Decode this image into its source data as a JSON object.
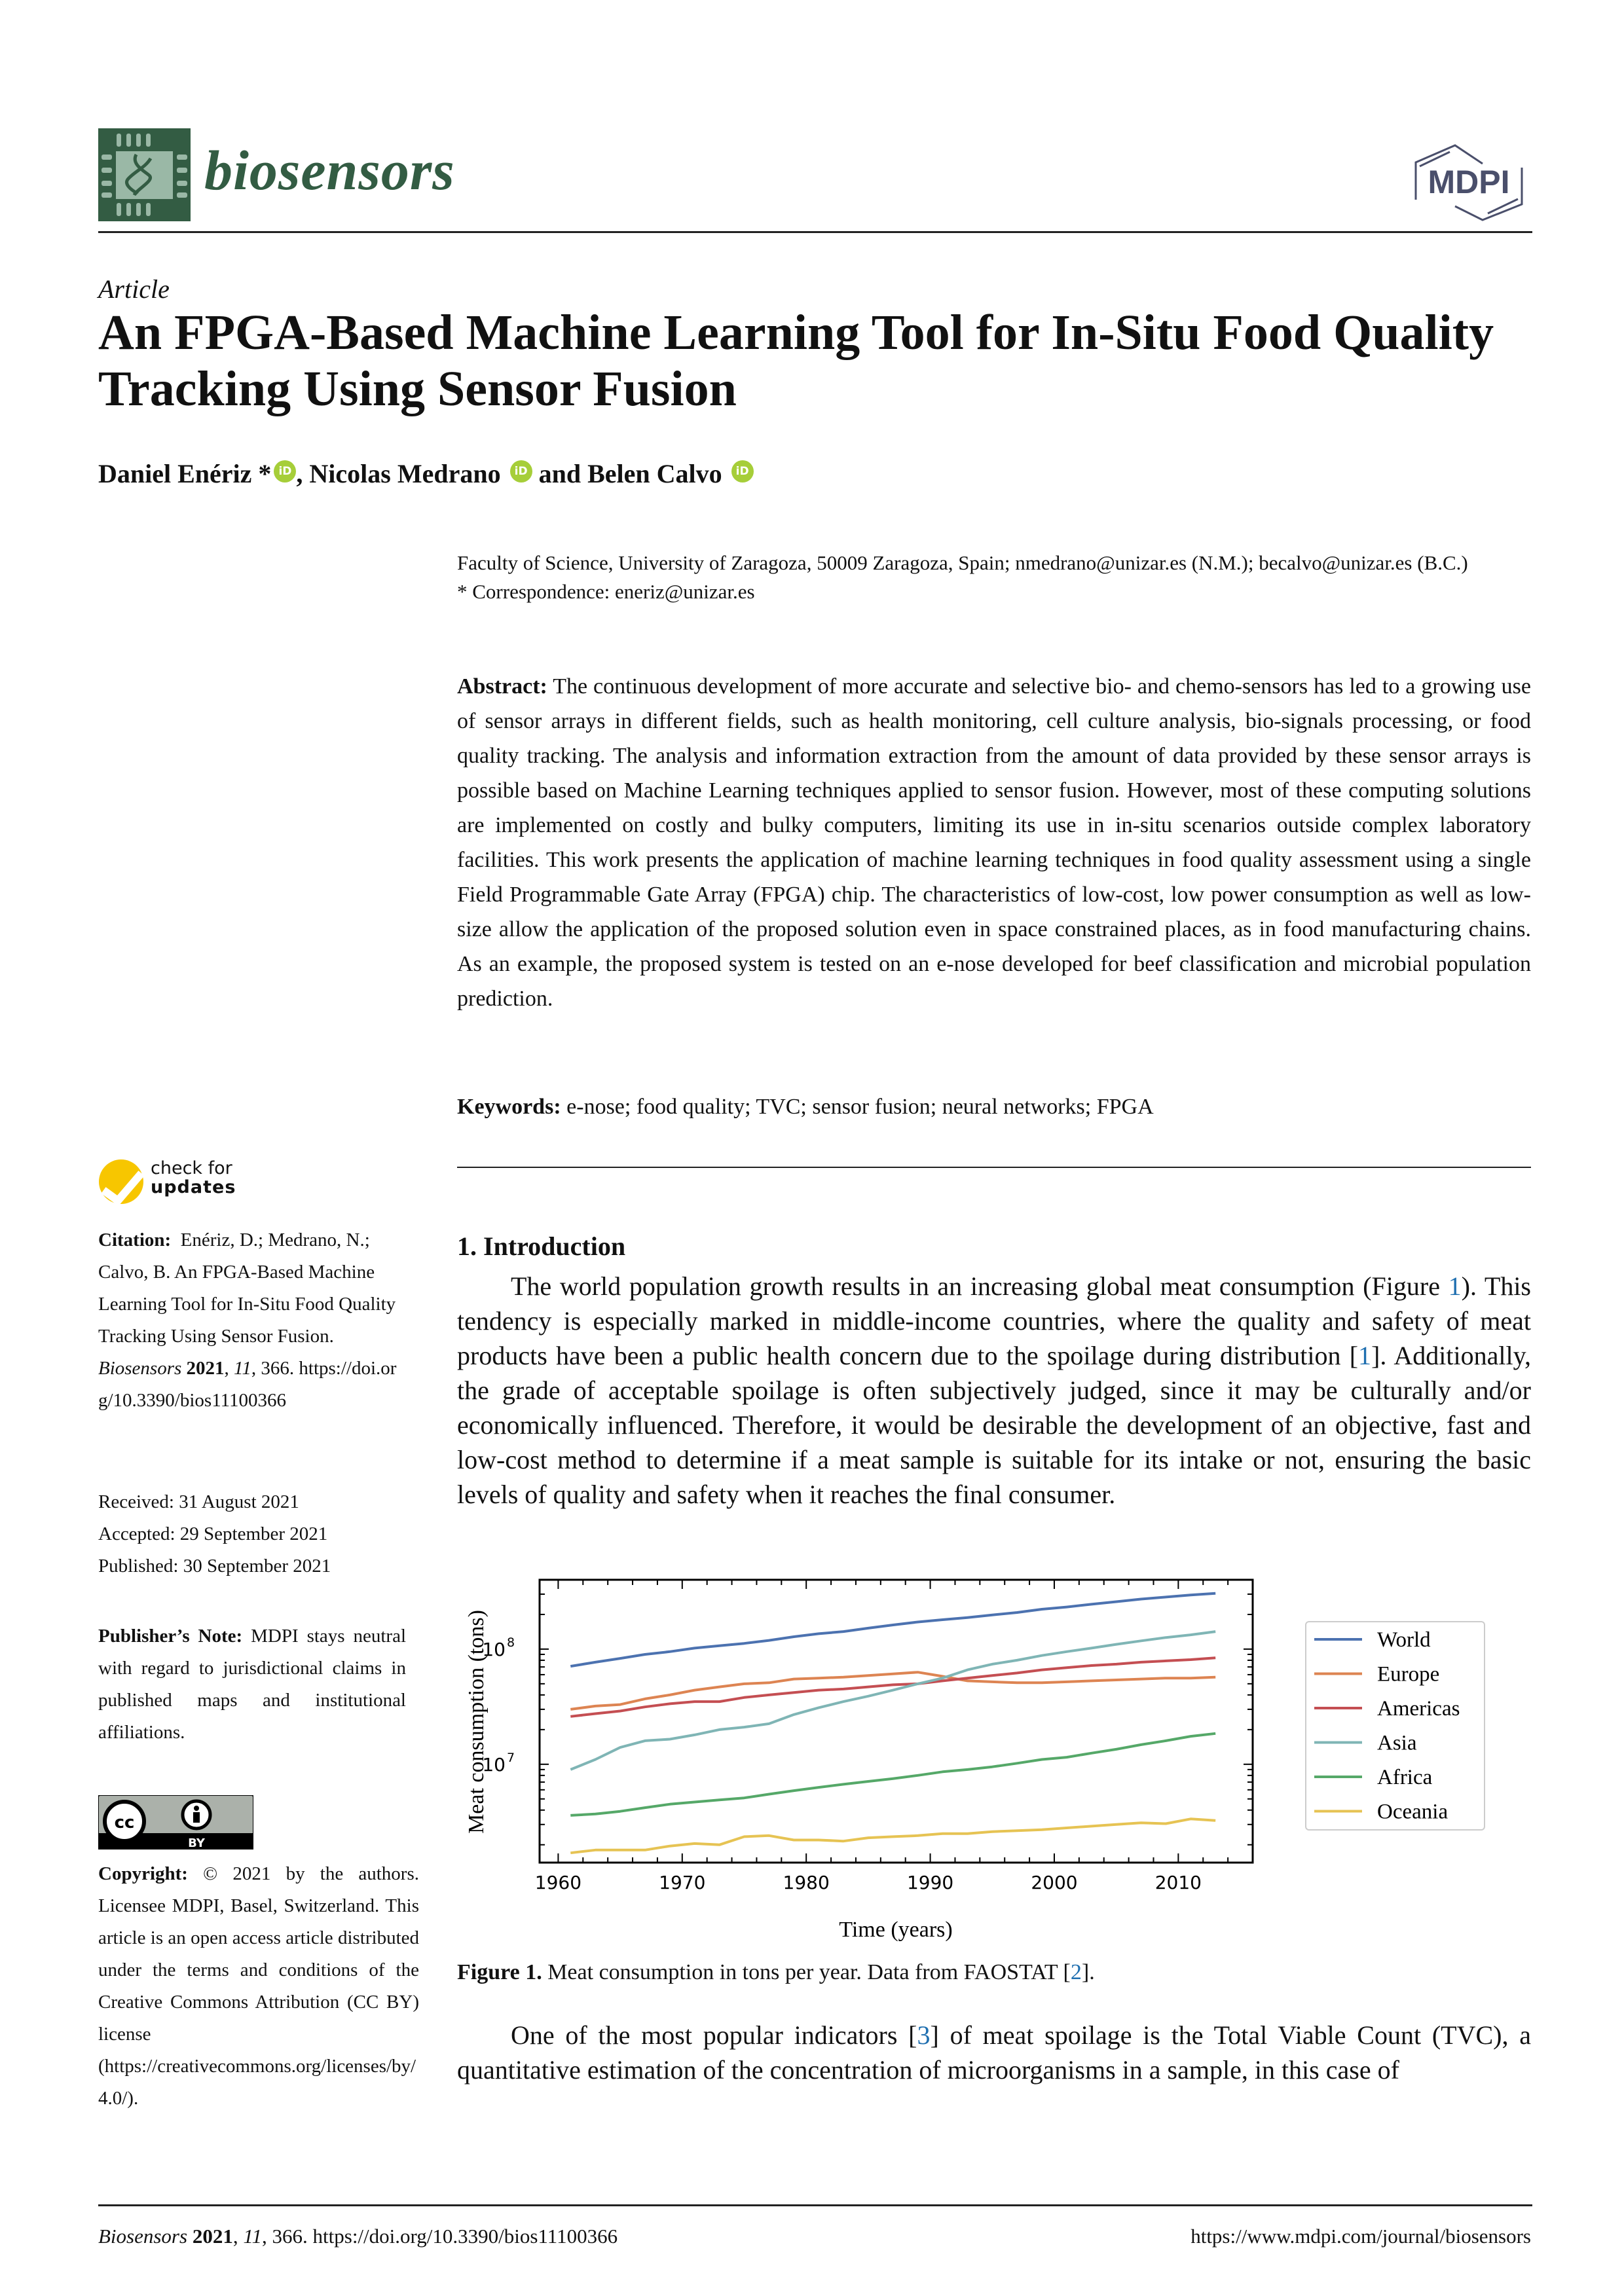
{
  "header": {
    "journal_name": "biosensors",
    "publisher": "MDPI"
  },
  "article": {
    "type": "Article",
    "title": "An FPGA-Based Machine Learning Tool for In-Situ Food Quality Tracking Using Sensor Fusion",
    "authors": [
      {
        "name": "Daniel Enériz",
        "mark": "*",
        "orcid": true
      },
      {
        "name": "Nicolas Medrano",
        "mark": "",
        "orcid": true
      },
      {
        "name": "Belen Calvo",
        "mark": "",
        "orcid": true
      }
    ],
    "author_sep_1": ", ",
    "author_sep_2": " and ",
    "orcid_label": "iD",
    "affiliation_line1": "Faculty of Science, University of Zaragoza, 50009 Zaragoza, Spain; nmedrano@unizar.es (N.M.); becalvo@unizar.es (B.C.)",
    "correspondence": "*  Correspondence: eneriz@unizar.es",
    "abstract_label": "Abstract:",
    "abstract": "The continuous development of more accurate and selective bio- and chemo-sensors has led to a growing use of sensor arrays in different fields, such as health monitoring, cell culture analysis, bio-signals processing, or food quality tracking. The analysis and information extraction from the amount of data provided by these sensor arrays is possible based on Machine Learning techniques applied to sensor fusion. However, most of these computing solutions are implemented on costly and bulky computers, limiting its use in in-situ scenarios outside complex laboratory facilities. This work presents the application of machine learning techniques in food quality assessment using a single Field Programmable Gate Array (FPGA) chip.  The characteristics of low-cost, low power consumption as well as low-size allow the application of the proposed solution even in space constrained places, as in food manufacturing chains. As an example, the proposed system is tested on an e-nose developed for beef classification and microbial population prediction.",
    "keywords_label": "Keywords:",
    "keywords": "e-nose; food quality; TVC; sensor fusion; neural networks; FPGA"
  },
  "sidebar": {
    "check_updates_line1": "check for",
    "check_updates_line2": "updates",
    "citation_label": "Citation:",
    "citation_text": "Enériz, D.; Medrano, N.; Calvo, B. An FPGA-Based Machine Learning Tool for In-Situ Food Quality Tracking Using Sensor Fusion.",
    "citation_journal": "Biosensors",
    "citation_year": "2021",
    "citation_volume": "11",
    "citation_article": ", 366.",
    "citation_doi": "https://doi.org/10.3390/bios11100366",
    "received": "Received: 31 August 2021",
    "accepted": "Accepted: 29 September 2021",
    "published": "Published: 30 September 2021",
    "publisher_note_label": "Publisher’s Note:",
    "publisher_note": "MDPI stays neutral with regard to jurisdictional claims in published maps and institutional affiliations.",
    "cc_label": "cc",
    "by_label": "BY",
    "copyright_label": "Copyright:",
    "copyright_text": "© 2021 by the authors. Licensee MDPI, Basel, Switzerland. This article is an open access article distributed under the terms and conditions of the Creative Commons Attribution (CC BY) license (https://creativecommons.org/licenses/by/4.0/)."
  },
  "intro": {
    "heading": "1. Introduction",
    "p1_a": "The world population growth results in an increasing global meat consumption (Figure ",
    "p1_ref1": "1",
    "p1_b": ").  This tendency is especially marked in middle-income countries, where the quality and safety of meat products have been a public health concern due to the spoilage during distribution [",
    "p1_ref2": "1",
    "p1_c": "]. Additionally, the grade of acceptable spoilage is often subjectively judged, since it may be culturally and/or economically influenced. Therefore, it would be desirable the development of an objective, fast and low-cost method to determine if a meat sample is suitable for its intake or not, ensuring the basic levels of quality and safety when it reaches the final consumer.",
    "caption_label": "Figure 1.",
    "caption_text": " Meat consumption in tons per year. Data from FAOSTAT [",
    "caption_ref": "2",
    "caption_end": "].",
    "p2_a": "One of the most popular indicators [",
    "p2_ref": "3",
    "p2_b": "] of meat spoilage is the Total Viable Count (TVC), a quantitative estimation of the concentration of microorganisms in a sample, in this case of"
  },
  "footer": {
    "journal": "Biosensors",
    "year": "2021",
    "volume": "11",
    "rest": ", 366. https://doi.org/10.3390/bios11100366",
    "url": "https://www.mdpi.com/journal/biosensors"
  },
  "chart_data": {
    "type": "line",
    "title": "",
    "xlabel": "Time (years)",
    "ylabel": "Meat consumption (tons)",
    "yscale": "log",
    "xlim": [
      1958.5,
      2016
    ],
    "ylim": [
      1400000,
      400000000
    ],
    "x_ticks": [
      1960,
      1970,
      1980,
      1990,
      2000,
      2010
    ],
    "y_tick_labels": [
      {
        "value": 10000000,
        "label": "10",
        "exp": "7"
      },
      {
        "value": 100000000,
        "label": "10",
        "exp": "8"
      }
    ],
    "legend_position": "right",
    "x": [
      1961,
      1963,
      1965,
      1967,
      1969,
      1971,
      1973,
      1975,
      1977,
      1979,
      1981,
      1983,
      1985,
      1987,
      1989,
      1991,
      1993,
      1995,
      1997,
      1999,
      2001,
      2003,
      2005,
      2007,
      2009,
      2011,
      2013
    ],
    "series": [
      {
        "name": "World",
        "color": "#4c72b0",
        "values": [
          71000000,
          77000000,
          83000000,
          90000000,
          95000000,
          102000000,
          107000000,
          112000000,
          119000000,
          128000000,
          136000000,
          142000000,
          152000000,
          162000000,
          172000000,
          180000000,
          188000000,
          198000000,
          208000000,
          222000000,
          232000000,
          245000000,
          258000000,
          272000000,
          283000000,
          295000000,
          305000000
        ]
      },
      {
        "name": "Europe",
        "color": "#dd8452",
        "values": [
          30000000,
          32000000,
          33000000,
          37000000,
          40000000,
          44000000,
          47000000,
          50000000,
          51000000,
          55000000,
          56000000,
          57000000,
          59000000,
          61000000,
          63000000,
          58000000,
          53000000,
          52000000,
          51000000,
          51000000,
          52000000,
          53000000,
          54000000,
          55000000,
          56000000,
          56000000,
          57000000
        ]
      },
      {
        "name": "Americas",
        "color": "#c44e52",
        "values": [
          26000000,
          27500000,
          29000000,
          31500000,
          33500000,
          35000000,
          35000000,
          38000000,
          40000000,
          42000000,
          44000000,
          45000000,
          47000000,
          49000000,
          50000000,
          53000000,
          56000000,
          59000000,
          62000000,
          66000000,
          69000000,
          72000000,
          74000000,
          77000000,
          79000000,
          81000000,
          84000000
        ]
      },
      {
        "name": "Asia",
        "color": "#7fb5b5",
        "values": [
          9000000,
          11000000,
          14000000,
          16000000,
          16500000,
          18000000,
          20000000,
          21000000,
          22500000,
          27000000,
          31000000,
          35000000,
          39000000,
          44000000,
          50000000,
          56000000,
          66000000,
          74000000,
          80000000,
          88000000,
          95000000,
          102000000,
          110000000,
          118000000,
          126000000,
          133000000,
          142000000
        ]
      },
      {
        "name": "Africa",
        "color": "#55a868",
        "values": [
          3600000,
          3700000,
          3900000,
          4200000,
          4500000,
          4700000,
          4900000,
          5100000,
          5500000,
          5900000,
          6300000,
          6700000,
          7100000,
          7500000,
          8000000,
          8600000,
          9000000,
          9500000,
          10200000,
          11000000,
          11500000,
          12500000,
          13500000,
          14800000,
          16000000,
          17500000,
          18500000
        ]
      },
      {
        "name": "Oceania",
        "color": "#e6c353",
        "values": [
          1700000,
          1800000,
          1800000,
          1800000,
          1950000,
          2050000,
          2000000,
          2350000,
          2400000,
          2200000,
          2200000,
          2150000,
          2300000,
          2350000,
          2400000,
          2500000,
          2500000,
          2600000,
          2650000,
          2700000,
          2800000,
          2900000,
          3000000,
          3100000,
          3050000,
          3350000,
          3250000
        ]
      }
    ]
  }
}
